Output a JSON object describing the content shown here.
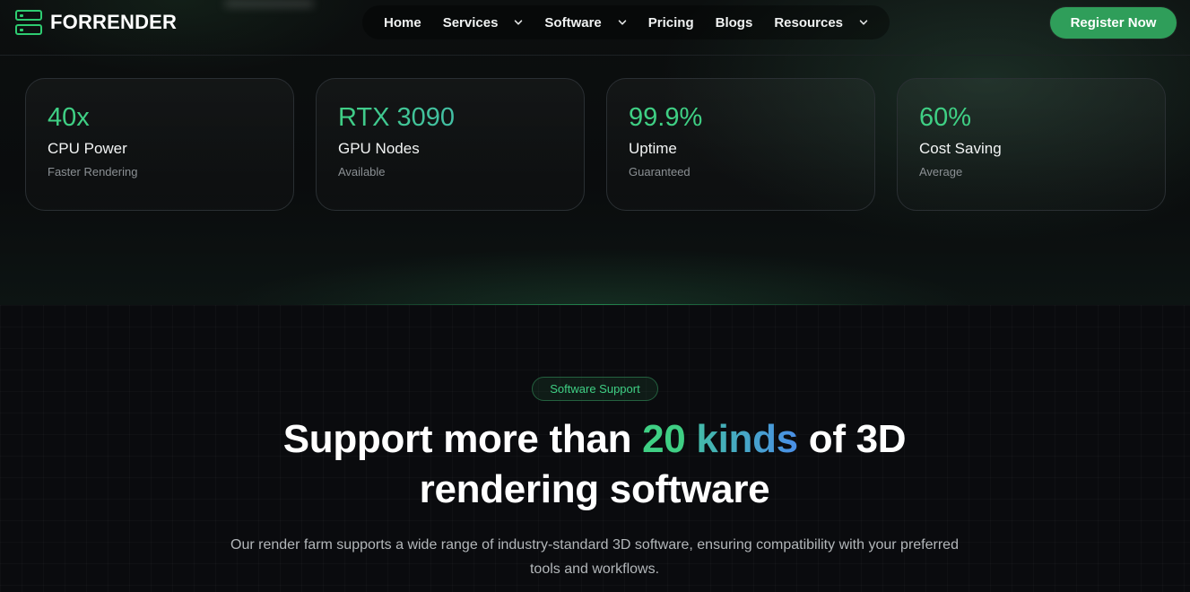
{
  "header": {
    "brand": "FORRENDER",
    "nav": [
      {
        "label": "Home",
        "has_dropdown": false
      },
      {
        "label": "Services",
        "has_dropdown": true
      },
      {
        "label": "Software",
        "has_dropdown": true
      },
      {
        "label": "Pricing",
        "has_dropdown": false
      },
      {
        "label": "Blogs",
        "has_dropdown": false
      },
      {
        "label": "Resources",
        "has_dropdown": true
      }
    ],
    "cta": "Register Now"
  },
  "stats": [
    {
      "value": "40x",
      "label": "CPU Power",
      "sub": "Faster Rendering"
    },
    {
      "value": "RTX 3090",
      "label": "GPU Nodes",
      "sub": "Available"
    },
    {
      "value": "99.9%",
      "label": "Uptime",
      "sub": "Guaranteed"
    },
    {
      "value": "60%",
      "label": "Cost Saving",
      "sub": "Average"
    }
  ],
  "section": {
    "badge": "Software Support",
    "headline": {
      "before": "Support more than ",
      "highlight_1": "20",
      "highlight_2": "kinds",
      "after_line1": " of 3D",
      "line2": "rendering software"
    },
    "description": "Our render farm supports a wide range of industry-standard 3D software, ensuring compatibility with your preferred tools and workflows."
  },
  "colors": {
    "accent_green": "#3fcf84",
    "button_green": "#2f9e5a",
    "gradient_blue": "#4a8fe8",
    "background": "#0a0b0e"
  }
}
